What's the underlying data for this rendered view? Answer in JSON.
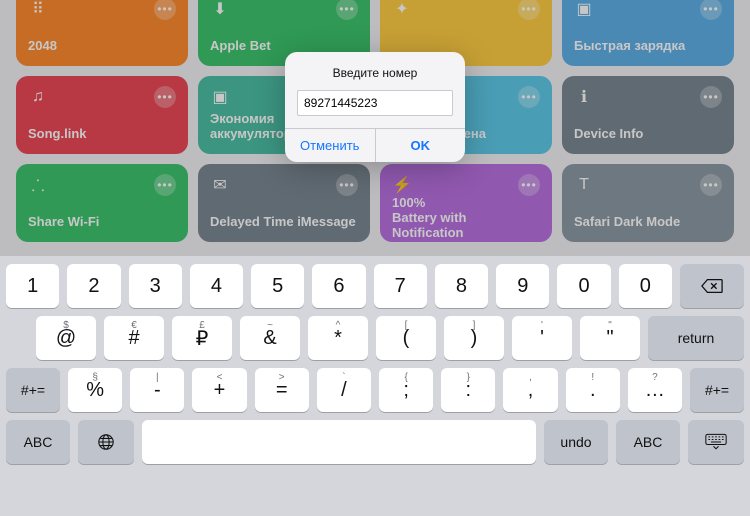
{
  "shortcuts": {
    "row1": [
      {
        "label": "2048",
        "color": "c-orange"
      },
      {
        "label": "Apple Bet",
        "color": "c-green"
      },
      {
        "label": "",
        "color": "c-yellow"
      },
      {
        "label": "Быстрая зарядка",
        "color": "c-blue"
      }
    ],
    "row2": [
      {
        "label": "Song.link",
        "color": "c-red",
        "sub": ""
      },
      {
        "label": "Экономия аккумулятора",
        "color": "c-teal"
      },
      {
        "label": "Буфер обмена",
        "color": "c-cyan"
      },
      {
        "label": "Device Info",
        "color": "c-slate"
      }
    ],
    "row3": [
      {
        "label": "Share Wi-Fi",
        "color": "c-green"
      },
      {
        "label": "Delayed Time iMessage",
        "color": "c-slate"
      },
      {
        "label": "100%\nBattery with Notification",
        "color": "c-purple"
      },
      {
        "label": "Safari Dark Mode",
        "color": "c-grey"
      }
    ]
  },
  "dialog": {
    "title": "Введите номер",
    "value": "89271445223",
    "cancel": "Отменить",
    "ok": "OK"
  },
  "keyboard": {
    "row1": [
      "1",
      "2",
      "3",
      "4",
      "5",
      "6",
      "7",
      "8",
      "9",
      "0",
      "0"
    ],
    "row2": {
      "hints": [
        "$",
        "€",
        "£",
        "~",
        "^",
        "[",
        "]",
        "'",
        "\"",
        " "
      ],
      "keys": [
        "@",
        "#",
        "₽",
        "&",
        "*",
        "(",
        ")",
        "'",
        "\"",
        "return"
      ]
    },
    "row3": {
      "side": "#+=",
      "hints": [
        "§",
        "|",
        "<",
        ">",
        "`",
        "{",
        "}",
        ",",
        "!",
        "?"
      ],
      "keys": [
        "%",
        "-",
        "+",
        "=",
        "/",
        ";",
        ":",
        ",",
        ".",
        "…"
      ]
    },
    "row4": {
      "abc": "ABC",
      "undo": "undo"
    }
  }
}
